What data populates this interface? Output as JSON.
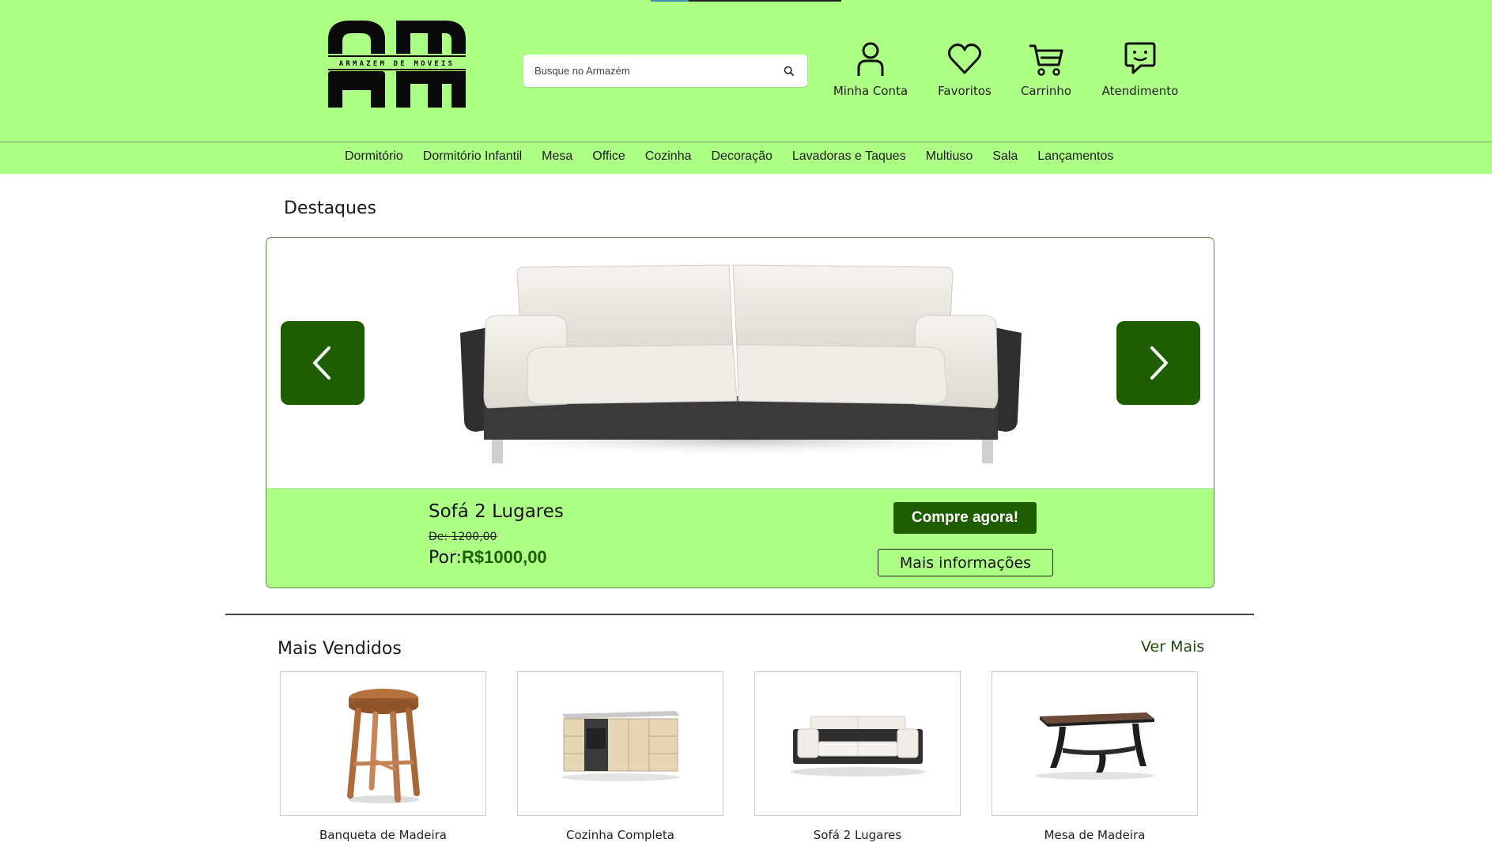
{
  "header": {
    "logo_text": "ARMAZEM DE MOVEIS",
    "search_placeholder": "Busque no Armazém",
    "icons": [
      {
        "label": "Minha Conta",
        "icon": "user-icon"
      },
      {
        "label": "Favoritos",
        "icon": "heart-icon"
      },
      {
        "label": "Carrinho",
        "icon": "cart-icon"
      },
      {
        "label": "Atendimento",
        "icon": "chat-smile-icon"
      }
    ]
  },
  "nav": {
    "items": [
      "Dormitório",
      "Dormitório Infantil",
      "Mesa",
      "Office",
      "Cozinha",
      "Decoração",
      "Lavadoras e Taques",
      "Multiuso",
      "Sala",
      "Lançamentos"
    ]
  },
  "highlights": {
    "title": "Destaques",
    "product": {
      "name": "Sofá 2 Lugares",
      "old_price": "De: 1200,00",
      "price_prefix": "Por:",
      "price": "R$1000,00",
      "buy_label": "Compre agora!",
      "more_label": "Mais informações"
    }
  },
  "best_sellers": {
    "title": "Mais Vendidos",
    "see_more": "Ver Mais",
    "items": [
      {
        "name": "Banqueta de Madeira"
      },
      {
        "name": "Cozinha Completa"
      },
      {
        "name": "Sofá 2 Lugares"
      },
      {
        "name": "Mesa de Madeira"
      }
    ]
  },
  "colors": {
    "header_bg": "#adff86",
    "accent_dark_green": "#1e5e00"
  }
}
